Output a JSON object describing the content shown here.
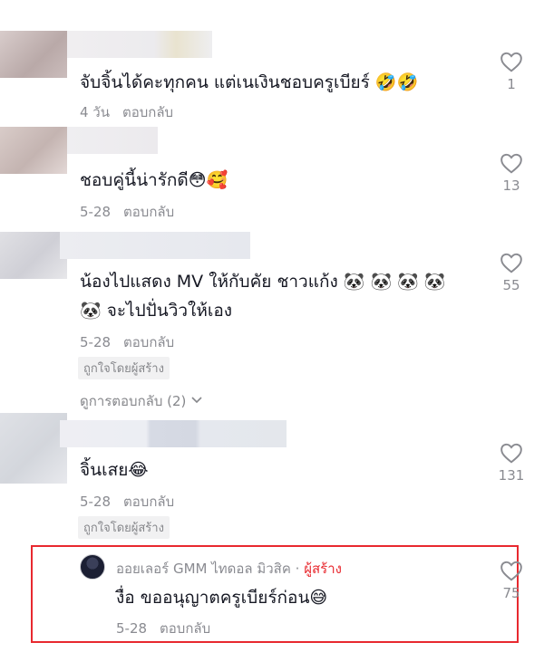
{
  "comments": [
    {
      "text": "จับจิ้นได้คะทุกคน แต่เนเงินชอบครูเบียร์ 🤣🤣",
      "time": "4 วัน",
      "reply_label": "ตอบกลับ",
      "likes": "1"
    },
    {
      "text": "ชอบคู่นี้น่ารักดี😳🥰",
      "time": "5-28",
      "reply_label": "ตอบกลับ",
      "likes": "13"
    },
    {
      "text_line1": "น้องไปแสดง MV ให้กับคัย ชาวแก้ง 🐼 🐼 🐼 🐼",
      "text_line2": "🐼 จะไปปั่นวิวให้เอง",
      "time": "5-28",
      "reply_label": "ตอบกลับ",
      "likes": "55",
      "liked_by_creator": "ถูกใจโดยผู้สร้าง",
      "view_replies": "ดูการตอบกลับ (2)"
    },
    {
      "text": "จิ้นเสย😂",
      "time": "5-28",
      "reply_label": "ตอบกลับ",
      "likes": "131",
      "liked_by_creator": "ถูกใจโดยผู้สร้าง"
    }
  ],
  "creator_reply": {
    "name": "ออยเลอร์ GMM ไทดอล มิวสิค",
    "separator": " · ",
    "creator_label": "ผู้สร้าง",
    "text": "งื่อ ขออนุญาตครูเบียร์ก่อน😅",
    "time": "5-28",
    "reply_label": "ตอบกลับ",
    "likes": "75"
  },
  "colors": {
    "highlight_border": "#e8292f",
    "muted_text": "#8a8b91",
    "creator_label": "#e8292f"
  },
  "icons": {
    "like": "heart-outline-icon",
    "expand": "chevron-down-icon"
  }
}
